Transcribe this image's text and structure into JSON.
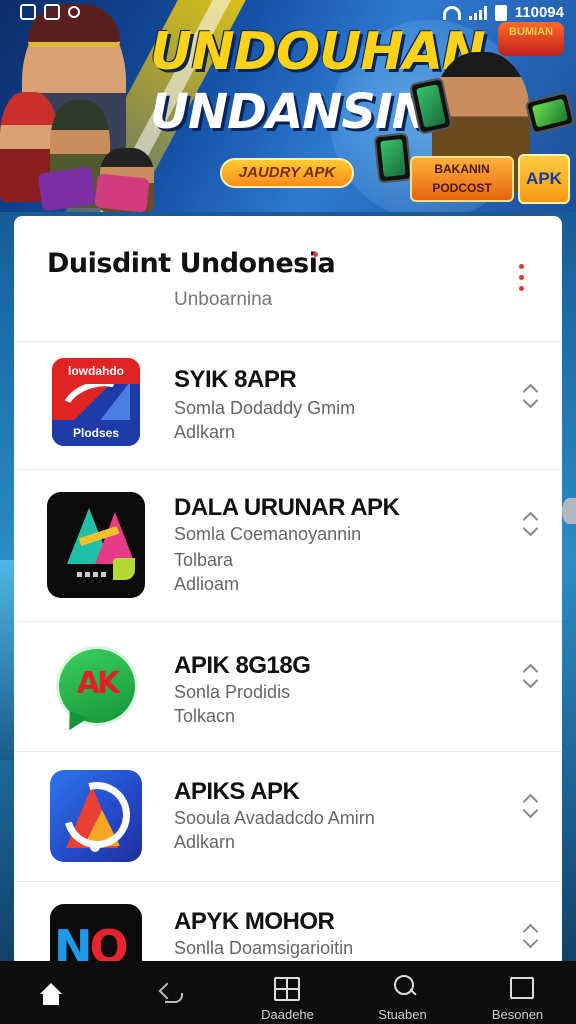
{
  "status_bar": {
    "left_icons": [
      "image-icon",
      "photo-icon",
      "notification-icon"
    ],
    "right_icons": [
      "wifi-icon",
      "signal-icon",
      "battery-icon"
    ],
    "time": "110094"
  },
  "banner": {
    "title_line1": "UNDOUHAN",
    "title_line2": "UNDANSINI",
    "pill_label": "JAUDRY APK",
    "logo_text": "BUMIAN",
    "download_label_1": "BAKANIN",
    "download_label_2": "PODCOST",
    "apk_badge": "APK",
    "accent_color": "#ffd21a"
  },
  "header": {
    "title": "Duisdint Undonesia",
    "subtitle": "Unboarnina",
    "menu_icon": "kebab-menu-icon"
  },
  "apps": [
    {
      "name": "SYIK 8APR",
      "line1": "Somla Dodaddy Gmim",
      "line2": "Adlkarn",
      "line3": "",
      "icon_top": "lowdahdo",
      "icon_bottom": "Plodses"
    },
    {
      "name": "DALA URUNAR APK",
      "line1": "Somla Coemanoyannin",
      "line2": "Tolbara",
      "line3": "Adlioam"
    },
    {
      "name": "APIK 8G18G",
      "line1": "Sonla Prodidis",
      "line2": "Tolkacn",
      "icon_text": "AK"
    },
    {
      "name": "APIKS APK",
      "line1": "Sooula Avadadcdo Amirn",
      "line2": "Adlkarn"
    },
    {
      "name": "APYK MOHOR",
      "line1": "Sonlla Doamsigarioitin",
      "line2": "",
      "icon_text_1": "N",
      "icon_text_2": "O"
    }
  ],
  "bottom_nav": [
    {
      "label": "",
      "icon": "home-icon"
    },
    {
      "label": "",
      "icon": "back-icon"
    },
    {
      "label": "Daadehe",
      "icon": "grid-icon"
    },
    {
      "label": "Stuaben",
      "icon": "search-icon"
    },
    {
      "label": "Besonen",
      "icon": "square-icon"
    }
  ]
}
